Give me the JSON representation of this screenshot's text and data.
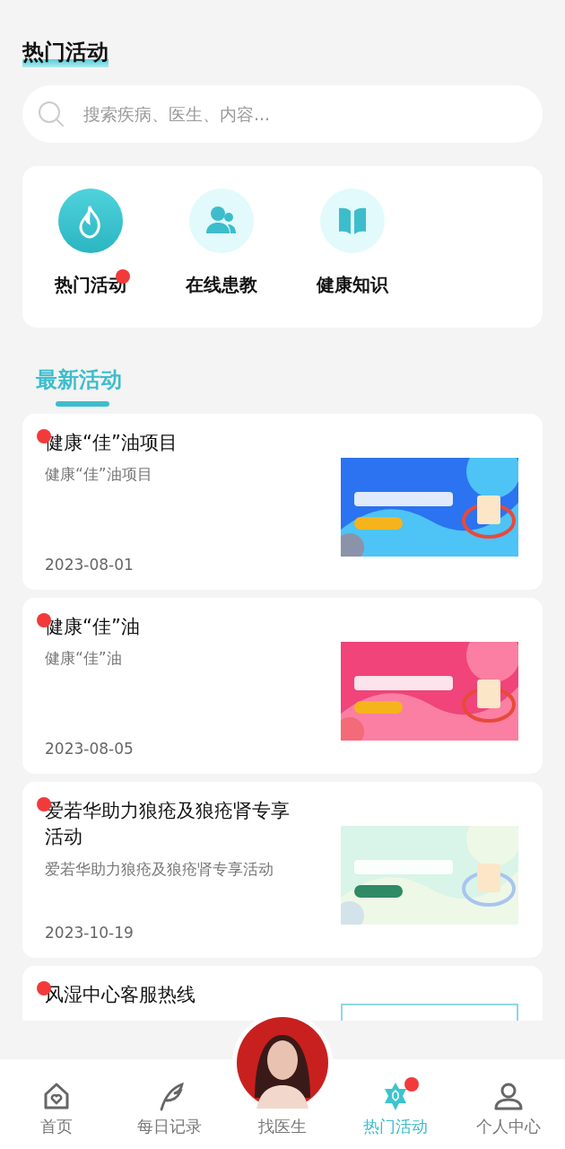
{
  "header": {
    "title": "热门活动"
  },
  "search": {
    "placeholder": "搜索疾病、医生、内容..."
  },
  "categories": [
    {
      "label": "热门活动",
      "selected": true,
      "badge": true
    },
    {
      "label": "在线患教",
      "selected": false,
      "badge": false
    },
    {
      "label": "健康知识",
      "selected": false,
      "badge": false
    }
  ],
  "section": {
    "title": "最新活动"
  },
  "activities": [
    {
      "title": "健康“佳”油项目",
      "subtitle": "健康“佳”油项目",
      "date": "2023-08-01",
      "unread": true
    },
    {
      "title": "健康“佳”油",
      "subtitle": "健康“佳”油",
      "date": "2023-08-05",
      "unread": true
    },
    {
      "title": "爱若华助力狼疮及狼疮肾专享活动",
      "subtitle": "爱若华助力狼疮及狼疮肾专享活动",
      "date": "2023-10-19",
      "unread": true
    },
    {
      "title": "风湿中心客服热线",
      "unread": true
    }
  ],
  "nav": [
    {
      "label": "首页",
      "selected": false,
      "badge": false
    },
    {
      "label": "每日记录",
      "selected": false,
      "badge": false
    },
    {
      "label": "找医生",
      "selected": false,
      "badge": false
    },
    {
      "label": "热门活动",
      "selected": true,
      "badge": true
    },
    {
      "label": "个人中心",
      "selected": false,
      "badge": false
    }
  ]
}
